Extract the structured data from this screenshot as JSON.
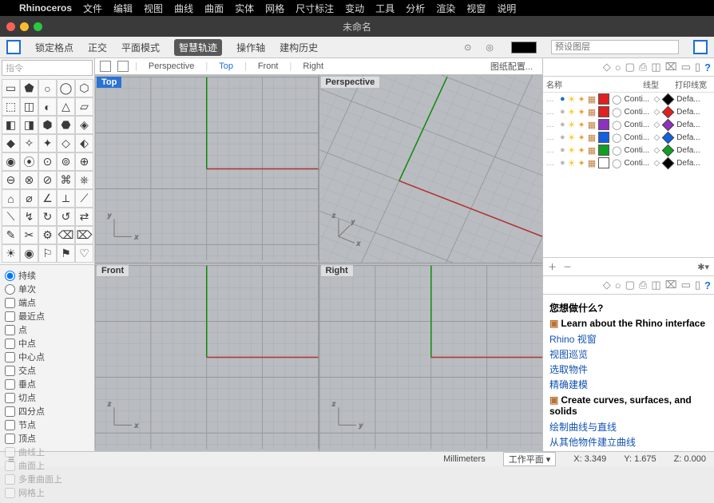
{
  "menubar": {
    "apple": "",
    "app": "Rhinoceros",
    "items": [
      "文件",
      "编辑",
      "视图",
      "曲线",
      "曲面",
      "实体",
      "网格",
      "尺寸标注",
      "变动",
      "工具",
      "分析",
      "渲染",
      "视窗",
      "说明"
    ]
  },
  "titlebar": {
    "doc": "未命名"
  },
  "toolbar": {
    "lock": "锁定格点",
    "ortho": "正交",
    "planar": "平面模式",
    "smart": "智慧轨迹",
    "gumball": "操作轴",
    "history": "建构历史",
    "preset_layer": "预设图层"
  },
  "command": {
    "placeholder": "指令"
  },
  "tools": [
    "▭",
    "⬟",
    "○",
    "◯",
    "⬡",
    "⬚",
    "◫",
    "◐",
    "△",
    "▱",
    "◧",
    "◨",
    "⬢",
    "⬣",
    "◈",
    "◆",
    "✧",
    "✦",
    "◇",
    "⬖",
    "◉",
    "⦿",
    "⊙",
    "⊚",
    "⊕",
    "⊖",
    "⊗",
    "⊘",
    "⌘",
    "⎈",
    "⌂",
    "⌀",
    "∠",
    "⟂",
    "⟋",
    "⟍",
    "↯",
    "↻",
    "↺",
    "⇄",
    "✎",
    "✂",
    "⚙",
    "⌫",
    "⌦",
    "☀",
    "◉",
    "⚐",
    "⚑",
    "♡"
  ],
  "osnap": {
    "radios": [
      {
        "label": "持续",
        "checked": true
      },
      {
        "label": "单次",
        "checked": false
      }
    ],
    "checks": [
      "端点",
      "最近点",
      "点",
      "中点",
      "中心点",
      "交点",
      "垂点",
      "切点",
      "四分点",
      "节点",
      "顶点"
    ],
    "disabled": [
      "曲线上",
      "曲面上",
      "多重曲面上",
      "网格上"
    ]
  },
  "viewtabs": {
    "items": [
      "Perspective",
      "Top",
      "Front",
      "Right"
    ],
    "active": "Top",
    "config": "图纸配置..."
  },
  "viewports": {
    "topLeft": {
      "label": "Top",
      "active": true,
      "axes": [
        "x",
        "y"
      ]
    },
    "topRight": {
      "label": "Perspective",
      "active": false,
      "axes": [
        "x",
        "y",
        "z"
      ]
    },
    "bottomLeft": {
      "label": "Front",
      "active": false,
      "axes": [
        "x",
        "z"
      ]
    },
    "bottomRight": {
      "label": "Right",
      "active": false,
      "axes": [
        "y",
        "z"
      ]
    }
  },
  "layerPanel": {
    "headers": {
      "name": "名称",
      "lt": "线型",
      "pw": "打印线宽"
    },
    "rows": [
      {
        "color": "#e02020",
        "lt": "Conti...",
        "pc": "#000000",
        "pw": "Defa...",
        "on": true
      },
      {
        "color": "#e02020",
        "lt": "Conti...",
        "pc": "#e02020",
        "pw": "Defa...",
        "on": false
      },
      {
        "color": "#9030c0",
        "lt": "Conti...",
        "pc": "#9030c0",
        "pw": "Defa...",
        "on": false
      },
      {
        "color": "#1060e0",
        "lt": "Conti...",
        "pc": "#1060e0",
        "pw": "Defa...",
        "on": false
      },
      {
        "color": "#10a020",
        "lt": "Conti...",
        "pc": "#10a020",
        "pw": "Defa...",
        "on": false
      },
      {
        "color": "#ffffff",
        "lt": "Conti...",
        "pc": "#000000",
        "pw": "Defa...",
        "on": false
      }
    ]
  },
  "help": {
    "title": "您想做什么?",
    "sec1": "Learn about the Rhino interface",
    "links1": [
      "Rhino 视窗",
      "视图巡览",
      "选取物件",
      "精确建模"
    ],
    "sec2": "Create curves, surfaces, and solids",
    "links2": [
      "绘制曲线与直线",
      "从其他物件建立曲线"
    ]
  },
  "status": {
    "units": "Millimeters",
    "cplane": "工作平面",
    "x": "X: 3.349",
    "y": "Y: 1.675",
    "z": "Z: 0.000"
  }
}
